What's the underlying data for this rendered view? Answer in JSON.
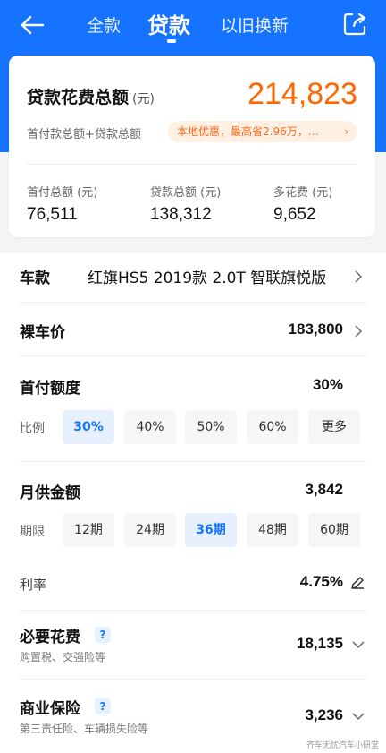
{
  "nav": {
    "tabs": [
      {
        "label": "全款"
      },
      {
        "label": "贷款"
      },
      {
        "label": "以旧换新"
      }
    ],
    "active_tab": "贷款"
  },
  "summary": {
    "title": "贷款花费总额",
    "title_unit": "(元)",
    "total": "214,823",
    "formula": "首付款总额+贷款总额",
    "promo": "本地优惠，最高省2.96万，…",
    "stats": [
      {
        "label": "首付总额 (元)",
        "value": "76,511"
      },
      {
        "label": "贷款总额 (元)",
        "value": "138,312"
      },
      {
        "label": "多花费 (元)",
        "value": "9,652"
      }
    ]
  },
  "model": {
    "label": "车款",
    "value": "红旗HS5 2019款 2.0T 智联旗悦版"
  },
  "price": {
    "label": "裸车价",
    "value": "183,800"
  },
  "down_payment": {
    "label": "首付额度",
    "value": "30%",
    "ratio_label": "比例",
    "options": [
      "30%",
      "40%",
      "50%",
      "60%",
      "更多"
    ],
    "selected_index": 0
  },
  "monthly": {
    "label": "月供金额",
    "value": "3,842",
    "term_label": "期限",
    "options": [
      "12期",
      "24期",
      "36期",
      "48期",
      "60期"
    ],
    "selected_index": 2
  },
  "rate": {
    "label": "利率",
    "value": "4.75%"
  },
  "necessary": {
    "label": "必要花费",
    "help": "?",
    "sub": "购置税、交强险等",
    "value": "18,135"
  },
  "insurance": {
    "label": "商业保险",
    "help": "?",
    "sub": "第三责任险、车辆损失险等",
    "value": "3,236"
  },
  "watermark": "齐车无忧汽车小研堂",
  "colors": {
    "brand": "#1673ff",
    "accent": "#ff6600",
    "promo_bg": "#fff0e4"
  }
}
